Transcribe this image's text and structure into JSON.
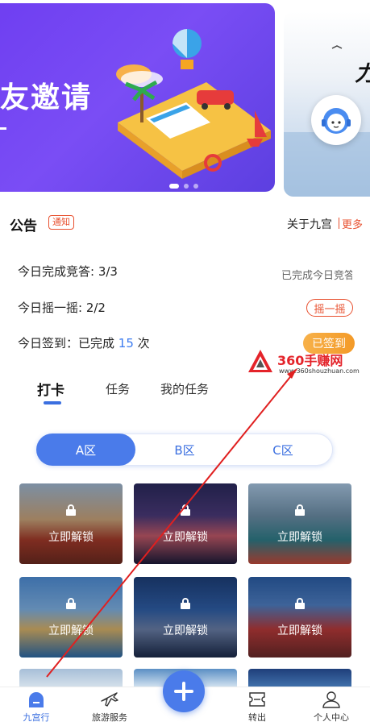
{
  "banner": {
    "title": "友邀请",
    "dots": 3
  },
  "notice": {
    "logo_text": "公告",
    "badge": "通知",
    "text": "关于九宫",
    "more": "更多"
  },
  "tasks": [
    {
      "label": "今日完成竞答: 3/3",
      "right_text": "已完成今日竞答"
    },
    {
      "label": "今日摇一摇: 2/2",
      "action": "摇一摇"
    },
    {
      "label_prefix": "今日签到：已完成",
      "count": "15",
      "label_suffix": "次",
      "action": "已签到"
    }
  ],
  "watermark": {
    "brand": "360手赚网",
    "url": "www.360shouzhuan.com"
  },
  "tabs": [
    {
      "label": "打卡",
      "active": true
    },
    {
      "label": "任务",
      "active": false
    },
    {
      "label": "我的任务",
      "active": false
    }
  ],
  "zones": [
    {
      "label": "A区",
      "active": true
    },
    {
      "label": "B区",
      "active": false
    },
    {
      "label": "C区",
      "active": false
    }
  ],
  "cards": {
    "unlock_label": "立即解锁"
  },
  "bottom_nav": [
    {
      "label": "九宫行",
      "icon": "home-icon",
      "active": true
    },
    {
      "label": "旅游服务",
      "icon": "plane-icon",
      "active": false
    },
    {
      "label": "",
      "icon": "plus-icon",
      "active": false
    },
    {
      "label": "转出",
      "icon": "ticket-icon",
      "active": false
    },
    {
      "label": "个人中心",
      "icon": "person-icon",
      "active": false
    }
  ],
  "colors": {
    "accent": "#4a7bea",
    "alert": "#e8502f",
    "gold": "#f39a28"
  }
}
